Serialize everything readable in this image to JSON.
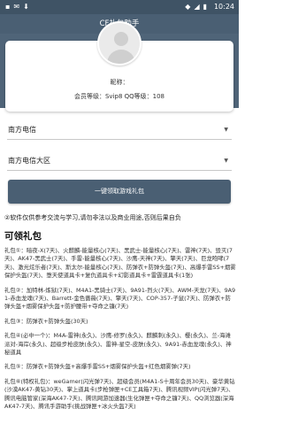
{
  "status_bar": {
    "time": "10:24",
    "left_icons": [
      "sim-icon",
      "notification-icon",
      "download-icon"
    ],
    "right_icons": [
      "wifi-icon",
      "signal-icon",
      "battery-icon"
    ]
  },
  "app_bar": {
    "title": "CF礼包助手"
  },
  "profile": {
    "nickname_label": "昵称：",
    "level_text": "会员等级：Svip8  QQ等级：108"
  },
  "selects": {
    "region": {
      "value": "南方电信"
    },
    "server": {
      "value": "南方电信大区"
    }
  },
  "primary_button": {
    "label": "一键领取游戏礼包"
  },
  "notice": "②软件仅供参考交流与学习,请勿非法以及商业用途,否则后果自负",
  "section_title": "可领礼包",
  "packs": [
    "礼包①：暗夜-X(7天)、火麒麟-能量核心(7天)、黑武士-能量核心(7天)、雷神(7天)、毁灭(7天)、AK47-黑武士(7天)、手雷-能量核心(7天)、沙鹰-天神(7天)、擎天(7天)、巨龙咆哮(7天)、激光炫乐者(7天)、斯太尔-能量核心(7天)、防弹衣+防弹头盔(7天)、高爆手雷SS+烟雾保护头盔(7天)、堕天使道具卡+复仇道具卡+幻影道具卡+雷霆道具卡(1张)",
    "礼包②：加特林-炼狱(7天)、M4A1-黑骑士(7天)、9A91-烈火(7天)、AWM-天龙(7天)、9A91-赤血龙魂(7天)、Barrett-金色蔷薇(7天)、擎天(7天)、COP-357-子鼠(7天)、防弹衣+防弹头盔+烟雾保护头盔+防护腰带+夺命之镰(7天)",
    "礼包③：防弹衣+防弹头盔(30天)",
    "礼包④(必中一个)：M4A-雷神(永久)、沙鹰-修罗(永久)、麒麟刺(永久)、樱(永久)、兰-海滩派对-海岸(永久)、超级步枪皮肤(永久)、雷神-星空-皮肤(永久)、9A91-赤血龙魂(永久)、神秘道具",
    "礼包⑤：防弹衣+防弹头盔+高爆手雷SS+烟雾保护头盔+红色烟雾弹(7天)",
    "礼包⑥(特权礼包)：weGamer(闪光弹7天)、超级会员(M4A1-S十周年会员30天)、豪华黄钻(沙漠AK47-黄钻30天)、掌上道具卡(步枪弹匣+CE工具箱7天)、腾讯视频VIP(闪光弹7天)、腾讯电脑管家(深海AK47-7天)、腾讯网游加速器(生化弹匣+夺命之镰7天)、QQ浏览器(深海AK47-7天)、腾讯手游助手(挑战弹匣+冰火头盔7天)"
  ]
}
